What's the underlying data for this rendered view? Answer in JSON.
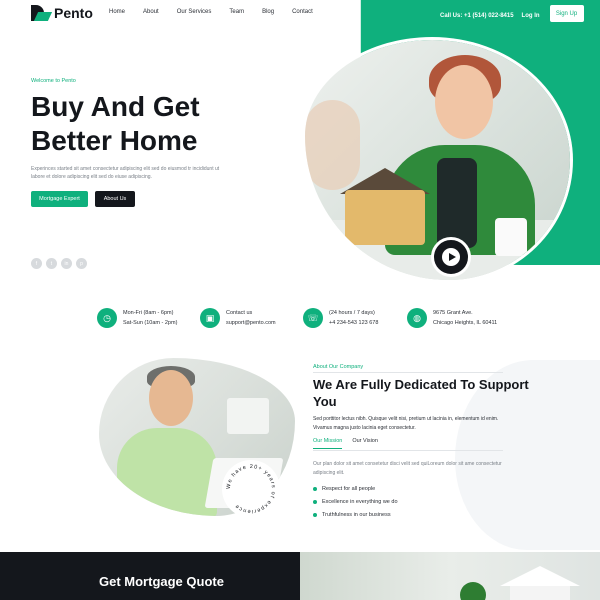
{
  "brand": {
    "name": "Pento",
    "accent": "#0fb07d",
    "dark": "#14171c"
  },
  "nav": {
    "menu": [
      "Home",
      "About",
      "Our Services",
      "Team",
      "Blog",
      "Contact"
    ],
    "phone": "Call Us: +1 (514) 022-8415",
    "login": "Log In",
    "signup": "Sign Up"
  },
  "hero": {
    "eyebrow": "Welcome to Pento",
    "title": "Buy And Get Better Home",
    "description": "Experinces started sit amet consectetur adipiscing elit sed do eiusmod tr incididunt ut labore et dolore adipiscing elit sed do eiuse adipiscing.",
    "primary_button": "Mortgage Expert",
    "secondary_button": "About Us",
    "socials": [
      "facebook-icon",
      "twitter-icon",
      "linkedin-icon",
      "pinterest-icon"
    ]
  },
  "info": [
    {
      "icon": "clock-icon",
      "line1": "Mon-Fri (8am - 6pm)",
      "line2": "Sat-Sun (10am - 2pm)"
    },
    {
      "icon": "contact-icon",
      "line1": "Contact us",
      "line2": "support@pento.com"
    },
    {
      "icon": "phone-icon",
      "line1": "(24 hours / 7 days)",
      "line2": "+4 234-543 123 678"
    },
    {
      "icon": "globe-icon",
      "line1": "9675 Grant Ave.",
      "line2": "Chicago Heights, IL 60411"
    }
  ],
  "about": {
    "eyebrow": "About Our Company",
    "title": "We Are Fully Dedicated To Support You",
    "description": "Sed porttitor lectus nibh. Quisque velit nisi, pretium ut lacinia in, elementum id enim. Vivamus magna justo lacinia eget consectetur.",
    "badge": "We have 20+ years of experience",
    "tabs": [
      "Our Mission",
      "Our Vision"
    ],
    "mission_text": "Our plan dolor sit amet consetetur disci velit sed quiLoreum dolor sit ame consectetur adipiscing elit.",
    "list": [
      "Respect for all people",
      "Excellence in everything we do",
      "Truthfulness in our business"
    ]
  },
  "quote": {
    "title": "Get Mortgage Quote"
  }
}
